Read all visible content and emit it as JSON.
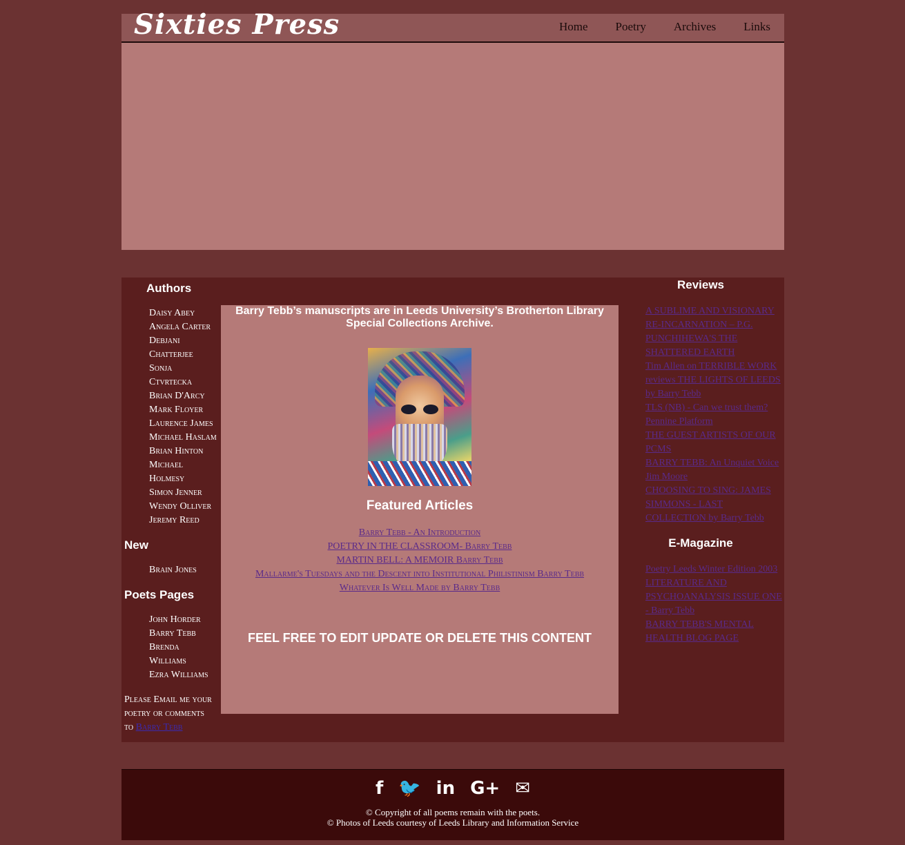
{
  "header": {
    "logo": "Sixties Press",
    "nav": [
      "Home",
      "Poetry",
      "Archives",
      "Links"
    ]
  },
  "left": {
    "authors_title": "Authors",
    "authors": [
      "Daisy Abey",
      "Angela Carter",
      "Debjani",
      "Chatterjee",
      "Sonja",
      "Ctvrtecka",
      "Brian D'Arcy",
      "Mark Floyer",
      "Laurence James",
      "Michael Haslam",
      "Brian Hinton",
      "Michael",
      "Holmesy",
      "Simon Jenner",
      "Wendy Olliver",
      "Jeremy Reed"
    ],
    "new_title": "New",
    "new_items": [
      "Brain Jones"
    ],
    "poets_title": "Poets Pages",
    "poets": [
      "John Horder",
      "Barry Tebb",
      "Brenda",
      "Williams",
      "Ezra Williams"
    ],
    "email_text_1": "Please Email me your",
    "email_text_2": "poetry or comments",
    "email_text_3": "to",
    "email_link": "Barry Tebb"
  },
  "center": {
    "manuscripts": "Barry Tebb’s manuscripts are in Leeds University’s Brotherton Library Special Collections Archive.",
    "featured_title": "Featured Articles",
    "featured": [
      {
        "text": "Barry Tebb - An Introduction",
        "sc": true
      },
      {
        "text": "POETRY IN THE CLASSROOM- ",
        "sc": false,
        "extra": "Barry Tebb"
      },
      {
        "text": "MARTIN BELL: A MEMOIR ",
        "sc": false,
        "extra": "Barry Tebb"
      },
      {
        "text": "Mallarme's Tuesdays and the Descent into Institutional Philistinism Barry Tebb",
        "sc": true
      },
      {
        "text": "Whatever Is Well Made by Barry Tebb",
        "sc": true
      }
    ],
    "feel_free": "FEEL FREE TO EDIT UPDATE OR DELETE THIS CONTENT"
  },
  "right": {
    "reviews_title": "Reviews",
    "reviews": [
      "A SUBLIME AND VISIONARY RE-INCARNATION – P.G. PUNCHIHEWA'S THE SHATTERED EARTH",
      "Tim Allen on TERRIBLE WORK reviews THE LIGHTS OF LEEDS by Barry Tebb",
      "TLS (NB) - Can we trust them?",
      "Pennine Platform",
      "THE GUEST ARTISTS OF OUR PCMS",
      "BARRY TEBB: An Unquiet Voice Jim Moore",
      "CHOOSING TO SING: JAMES SIMMONS - LAST COLLECTION by Barry Tebb"
    ],
    "emag_title": "E-Magazine",
    "emag": [
      "Poetry Leeds Winter Edition 2003",
      "LITERATURE AND PSYCHOANALYSIS ISSUE ONE - Barry Tebb",
      "BARRY TEBB'S MENTAL HEALTH BLOG PAGE"
    ]
  },
  "footer": {
    "icons": [
      "facebook-icon",
      "twitter-icon",
      "linkedin-icon",
      "google-plus-icon",
      "envelope-icon"
    ],
    "icon_glyphs": [
      "f",
      "🐦",
      "in",
      "G+",
      "✉"
    ],
    "copyright_1": "© Copyright of all poems remain with the poets.",
    "copyright_2": "© Photos of Leeds courtesy of Leeds Library and Information Service"
  }
}
